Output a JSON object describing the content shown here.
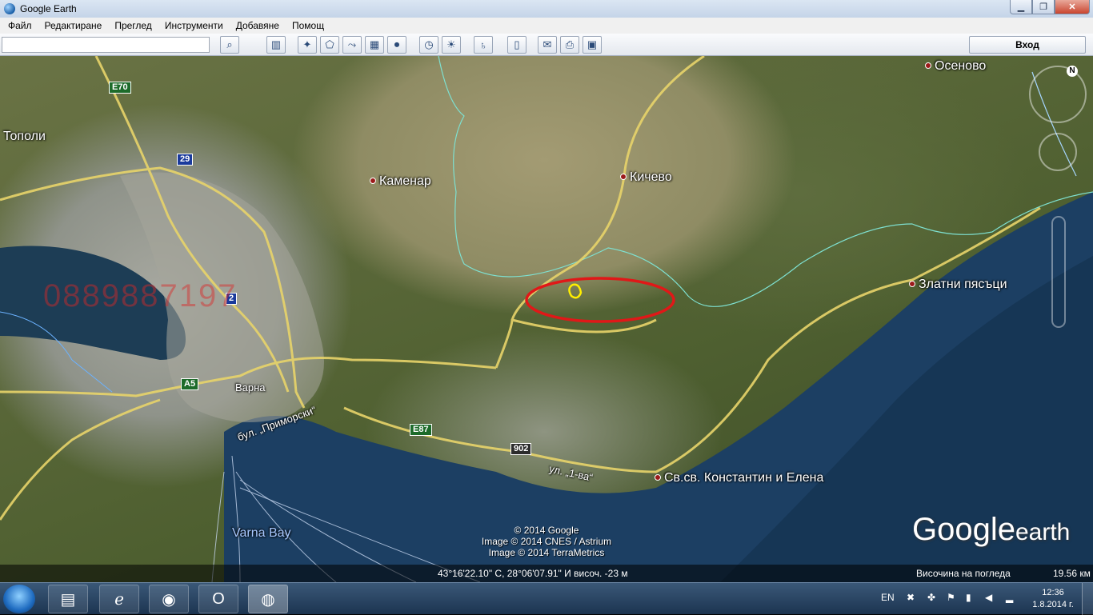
{
  "window": {
    "title": "Google Earth",
    "min_label": "▁",
    "max_label": "❐",
    "close_label": "✕"
  },
  "menu": [
    "Файл",
    "Редактиране",
    "Преглед",
    "Инструменти",
    "Добавяне",
    "Помощ"
  ],
  "toolbar": {
    "search_value": "",
    "login_label": "Вход",
    "buttons": [
      {
        "name": "search-button",
        "glyph": "⌕"
      },
      {
        "name": "sidebar-toggle-button",
        "glyph": "▥"
      },
      {
        "name": "add-placemark-button",
        "glyph": "✦"
      },
      {
        "name": "add-polygon-button",
        "glyph": "⬠"
      },
      {
        "name": "add-path-button",
        "glyph": "⤳"
      },
      {
        "name": "add-overlay-button",
        "glyph": "▦"
      },
      {
        "name": "record-tour-button",
        "glyph": "⏺"
      },
      {
        "name": "historical-imagery-button",
        "glyph": "◷"
      },
      {
        "name": "sunlight-button",
        "glyph": "☀"
      },
      {
        "name": "switch-planet-button",
        "glyph": "♄"
      },
      {
        "name": "ruler-button",
        "glyph": "▯"
      },
      {
        "name": "email-button",
        "glyph": "✉"
      },
      {
        "name": "print-button",
        "glyph": "⎙"
      },
      {
        "name": "save-image-button",
        "glyph": "▣"
      }
    ]
  },
  "map": {
    "places": [
      {
        "name": "place-osenovo",
        "label": "Осеново"
      },
      {
        "name": "place-topoli",
        "label": "Тополи"
      },
      {
        "name": "place-kamenar",
        "label": "Каменар"
      },
      {
        "name": "place-kichevo",
        "label": "Кичево"
      },
      {
        "name": "place-zlatni-pyasatsi",
        "label": "Златни пясъци"
      },
      {
        "name": "place-varna",
        "label": "Варна"
      },
      {
        "name": "place-sv-konstantin",
        "label": "Св.св. Константин и Елена"
      },
      {
        "name": "place-varna-bay",
        "label": "Varna Bay"
      },
      {
        "name": "road-primorski",
        "label": "бул. „Приморски“"
      },
      {
        "name": "road-pervi-va",
        "label": "ул. „1-ва“"
      }
    ],
    "shields": [
      {
        "name": "shield-e70",
        "label": "E70"
      },
      {
        "name": "shield-29",
        "label": "29"
      },
      {
        "name": "shield-2",
        "label": "2"
      },
      {
        "name": "shield-a5",
        "label": "A5"
      },
      {
        "name": "shield-e87",
        "label": "E87"
      },
      {
        "name": "shield-902",
        "label": "902"
      }
    ],
    "watermark_phone": "0889887197",
    "copyright": [
      "© 2014 Google",
      "Image © 2014 CNES / Astrium",
      "Image © 2014 TerraMetrics"
    ],
    "logo_text": "Google",
    "logo_suffix": "earth",
    "compass_label": "N"
  },
  "status": {
    "coords": "43°16'22.10\" С,  28°06'07.91\" И  височ.   -23 м",
    "eye_alt_label": "Височина на погледа",
    "eye_alt_value": "19.56 км"
  },
  "taskbar": {
    "lang": "EN",
    "time": "12:36",
    "date": "1.8.2014 г."
  },
  "colors": {
    "annotation_ellipse": "#e01818",
    "annotation_mark": "#ffee00",
    "road": "#e8d46a",
    "boundary": "#7ee0d0"
  }
}
